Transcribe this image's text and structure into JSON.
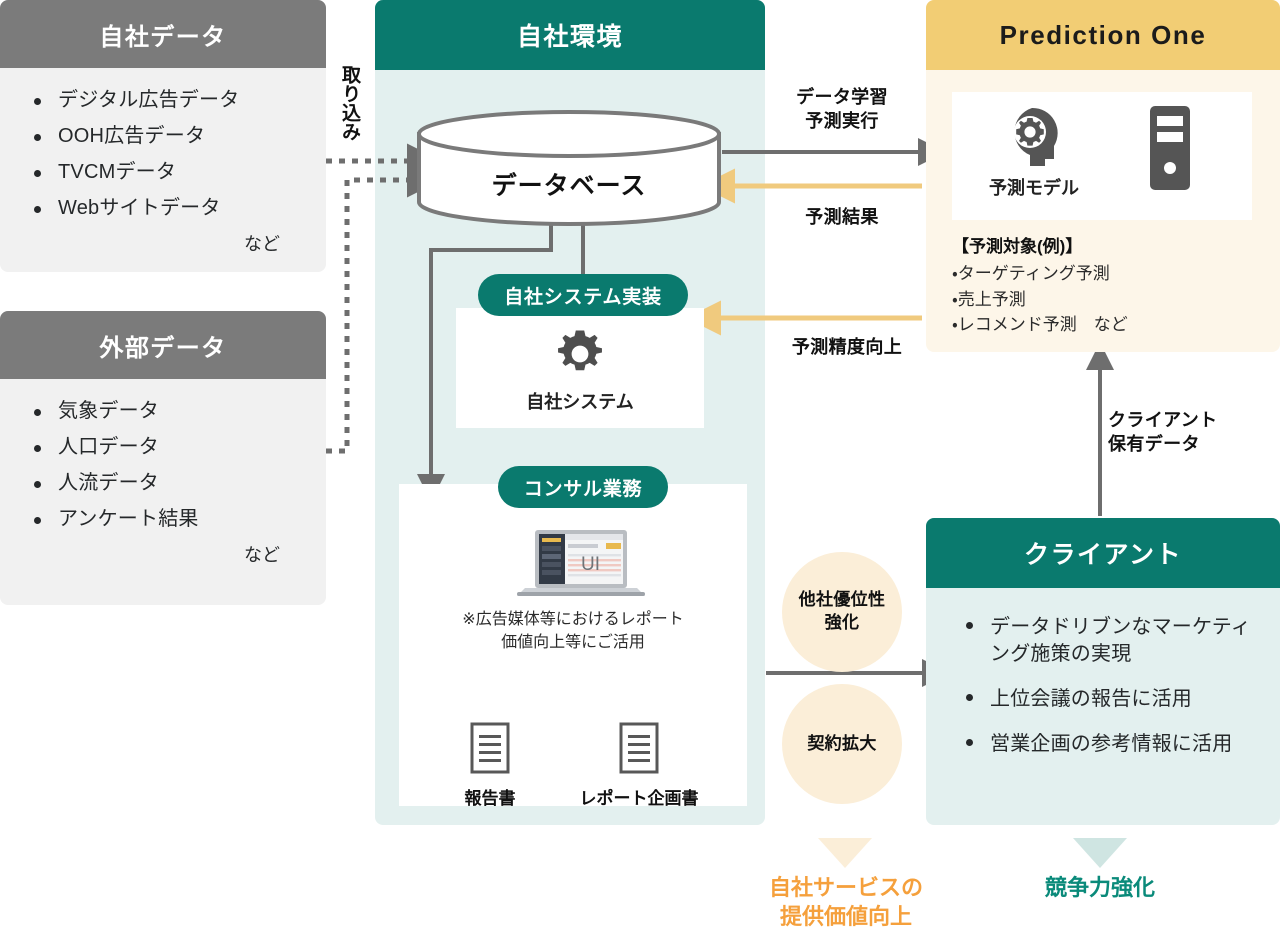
{
  "own_data": {
    "title": "自社データ",
    "items": [
      "デジタル広告データ",
      "OOH広告データ",
      "TVCMデータ",
      "Webサイトデータ"
    ],
    "etc": "など"
  },
  "external_data": {
    "title": "外部データ",
    "items": [
      "気象データ",
      "人口データ",
      "人流データ",
      "アンケート結果"
    ],
    "etc": "など"
  },
  "ingest_label": "取り込み",
  "own_env": {
    "title": "自社環境",
    "database_label": "データベース",
    "system_pill": "自社システム実装",
    "system_caption": "自社システム",
    "consult_pill": "コンサル業務",
    "ui_label": "UI",
    "note_line1": "※広告媒体等におけるレポート",
    "note_line2": "価値向上等にご活用",
    "doc_left": "報告書",
    "doc_right": "レポート企画書"
  },
  "prediction_one": {
    "title": "Prediction One",
    "model_caption": "予測モデル",
    "targets_heading": "【予測対象(例)】",
    "targets": [
      "・ターゲティング予測",
      "・売上予測",
      "・レコメンド予測　など"
    ]
  },
  "client": {
    "title": "クライアント",
    "items": [
      "データドリブンなマーケティング施策の実現",
      "上位会議の報告に活用",
      "営業企画の参考情報に活用"
    ]
  },
  "arrows": {
    "learn_line1": "データ学習",
    "learn_line2": "予測実行",
    "result": "予測結果",
    "accuracy": "予測精度向上",
    "client_data_line1": "クライアント",
    "client_data_line2": "保有データ"
  },
  "circles": {
    "advantage_line1": "他社優位性",
    "advantage_line2": "強化",
    "expand": "契約拡大"
  },
  "outcomes": {
    "service_line1": "自社サービスの",
    "service_line2": "提供価値向上",
    "competitive": "競争力強化"
  },
  "colors": {
    "teal": "#0a7a6e",
    "teal_light": "#e3f0ef",
    "gray_head": "#7b7b7b",
    "gray_body": "#f1f1f1",
    "amber": "#f2cd74",
    "amber_light": "#fdf6e9",
    "circle_fill": "#fbeed8",
    "orange_text": "#f5a03c",
    "arrow_gray": "#6e6e6e",
    "arrow_amber": "#f0ca7e"
  }
}
